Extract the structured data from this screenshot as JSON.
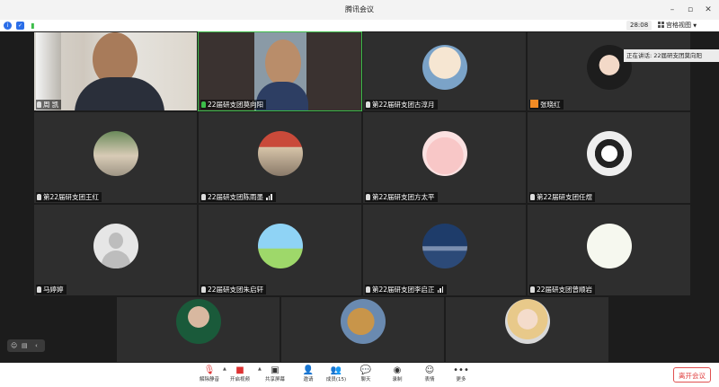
{
  "window": {
    "title": "腾讯会议"
  },
  "infobar": {
    "timer": "28:08",
    "view_label": "宫格视图"
  },
  "speaking": {
    "text": "正在讲话: 22届研支团莫向阳"
  },
  "participants": [
    {
      "name": "周  凯",
      "mic": "white"
    },
    {
      "name": "22届研支团莫向阳",
      "mic": "green"
    },
    {
      "name": "第22届研支团古淳月",
      "mic": "white"
    },
    {
      "name": "张晓红",
      "mic": "badge"
    },
    {
      "name": "第22届研支团王红",
      "mic": "white"
    },
    {
      "name": "22届研支团陈雨墨",
      "mic": "white",
      "signal": true
    },
    {
      "name": "第22届研支团方太平",
      "mic": "white"
    },
    {
      "name": "第22届研支团任煜",
      "mic": "white"
    },
    {
      "name": "马婷婷",
      "mic": "white"
    },
    {
      "name": "22届研支团朱启轩",
      "mic": "white"
    },
    {
      "name": "第22届研支团李启正",
      "mic": "white",
      "signal": true
    },
    {
      "name": "22届研支团曾顺岩",
      "mic": "white"
    }
  ],
  "toolbar": {
    "unmute": "解除静音",
    "start_video": "开启视频",
    "share_screen": "共享屏幕",
    "invite": "邀请",
    "members": "成员(15)",
    "chat": "聊天",
    "record": "录制",
    "reactions": "表情",
    "more": "更多",
    "leave": "离开会议"
  },
  "colors": {
    "active_border": "#3dbd4a",
    "leave_red": "#e04040",
    "badge_orange": "#f08a24"
  }
}
